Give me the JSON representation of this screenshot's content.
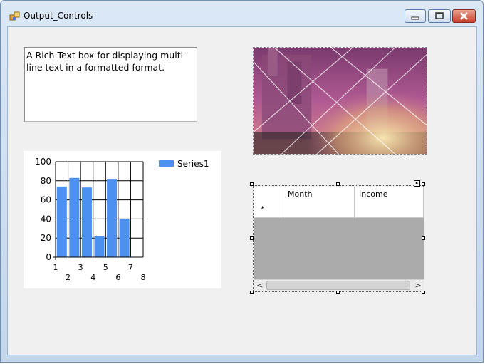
{
  "window": {
    "title": "Output_Controls",
    "icon": "form-app-icon",
    "buttons": [
      "minimize-button",
      "maximize-button",
      "close-button"
    ]
  },
  "richtext": {
    "text": "A Rich Text box for displaying multi-line text in a formatted format."
  },
  "picture": {
    "icon": "fireworks-night-image"
  },
  "chart_data": {
    "type": "bar",
    "categories": [
      "1",
      "2",
      "3",
      "4",
      "5",
      "6",
      "7"
    ],
    "series": [
      {
        "name": "Series1",
        "values": [
          74,
          83,
          73,
          22,
          82,
          40
        ],
        "x": [
          2,
          3,
          4,
          5,
          6,
          7
        ]
      }
    ],
    "xticks": [
      "1",
      "2",
      "3",
      "4",
      "5",
      "6",
      "7",
      "8"
    ],
    "yticks": [
      "0",
      "20",
      "40",
      "60",
      "80",
      "100"
    ],
    "ylim": [
      0,
      100
    ],
    "xlim": [
      1,
      8
    ],
    "legend": "top-right",
    "grid": true,
    "colors": {
      "bar": "#4d91f0",
      "grid": "#000000"
    }
  },
  "datagrid": {
    "columns": [
      "Month",
      "Income"
    ],
    "new_row_marker": "*",
    "scroll_left": "<",
    "scroll_right": ">",
    "background": "#ababab"
  }
}
